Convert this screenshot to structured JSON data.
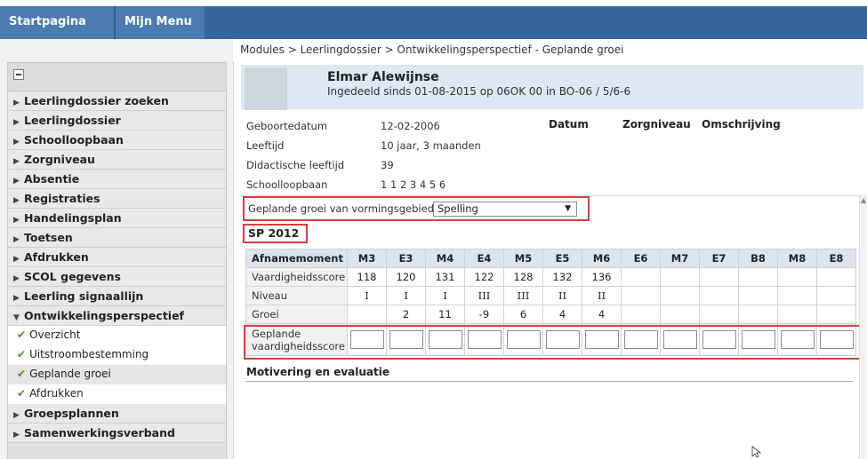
{
  "topbar": {
    "start_label": "Startpagina",
    "menu_label": "Mijn Menu"
  },
  "breadcrumb": "Modules > Leerlingdossier > Ontwikkelingsperspectief - Geplande groei",
  "sidebar": {
    "items": [
      {
        "label": "Leerlingdossier zoeken"
      },
      {
        "label": "Leerlingdossier"
      },
      {
        "label": "Schoolloopbaan"
      },
      {
        "label": "Zorgniveau"
      },
      {
        "label": "Absentie"
      },
      {
        "label": "Registraties"
      },
      {
        "label": "Handelingsplan"
      },
      {
        "label": "Toetsen"
      },
      {
        "label": "Afdrukken"
      },
      {
        "label": "SCOL gegevens"
      },
      {
        "label": "Leerling signaallijn"
      },
      {
        "label": "Ontwikkelingsperspectief"
      }
    ],
    "subitems": [
      {
        "label": "Overzicht"
      },
      {
        "label": "Uitstroombestemming"
      },
      {
        "label": "Geplande groei"
      },
      {
        "label": "Afdrukken"
      }
    ],
    "items_after": [
      {
        "label": "Groepsplannen"
      },
      {
        "label": "Samenwerkingsverband"
      }
    ]
  },
  "student": {
    "name": "Elmar Alewijnse",
    "info": "Ingedeeld sinds 01-08-2015 op 06OK 00 in BO-06 / 5/6-6"
  },
  "details": {
    "birth_label": "Geboortedatum",
    "birth_value": "12-02-2006",
    "age_label": "Leeftijd",
    "age_value": "10 jaar, 3 maanden",
    "didactic_label": "Didactische leeftijd",
    "didactic_value": "39",
    "career_label": "Schoolloopbaan",
    "career_value": "1 1 2 3 4 5 6"
  },
  "columns_header": {
    "datum": "Datum",
    "zorgniveau": "Zorgniveau",
    "omschrijving": "Omschrijving"
  },
  "select": {
    "label": "Geplande groei van vormingsgebied",
    "value": "Spelling"
  },
  "section_title": "SP 2012",
  "table": {
    "header_first": "Afnamemoment",
    "headers": [
      "M3",
      "E3",
      "M4",
      "E4",
      "M5",
      "E5",
      "M6",
      "E6",
      "M7",
      "E7",
      "B8",
      "M8",
      "E8"
    ],
    "rows": [
      {
        "label": "Vaardigheidsscore",
        "values": [
          "118",
          "120",
          "131",
          "122",
          "128",
          "132",
          "136",
          "",
          "",
          "",
          "",
          "",
          ""
        ]
      },
      {
        "label": "Niveau",
        "values": [
          "I",
          "I",
          "I",
          "III",
          "III",
          "II",
          "II",
          "",
          "",
          "",
          "",
          "",
          ""
        ]
      },
      {
        "label": "Groei",
        "values": [
          "",
          "2",
          "11",
          "-9",
          "6",
          "4",
          "4",
          "",
          "",
          "",
          "",
          "",
          ""
        ]
      }
    ],
    "input_row_label": "Geplande vaardigheidsscore"
  },
  "motivation_label": "Motivering en evaluatie"
}
